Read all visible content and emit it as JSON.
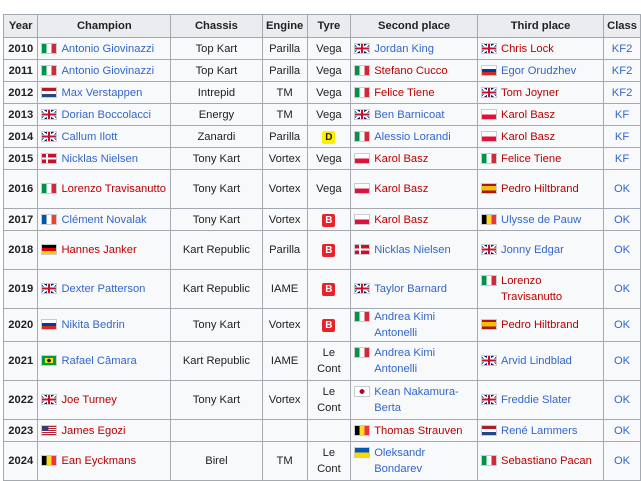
{
  "colors": {
    "link_blue": "#3366cc",
    "link_red": "#ba0000",
    "header_bg": "#eaecf0",
    "border": "#a2a9b1"
  },
  "headers": [
    "Year",
    "Champion",
    "Chassis",
    "Engine",
    "Tyre",
    "Second place",
    "Third place",
    "Class"
  ],
  "rows": [
    {
      "year": "2010",
      "champion": {
        "flag": "it",
        "name": "Antonio Giovinazzi",
        "color": "blue"
      },
      "chassis": "Top Kart",
      "engine": "Parilla",
      "tyre": {
        "text": "Vega"
      },
      "second": {
        "flag": "gb",
        "name": "Jordan King",
        "color": "blue"
      },
      "third": {
        "flag": "gb",
        "name": "Chris Lock",
        "color": "red"
      },
      "cls": "KF2"
    },
    {
      "year": "2011",
      "champion": {
        "flag": "it",
        "name": "Antonio Giovinazzi",
        "color": "blue"
      },
      "chassis": "Top Kart",
      "engine": "Parilla",
      "tyre": {
        "text": "Vega"
      },
      "second": {
        "flag": "it",
        "name": "Stefano Cucco",
        "color": "red"
      },
      "third": {
        "flag": "ru",
        "name": "Egor Orudzhev",
        "color": "blue"
      },
      "cls": "KF2"
    },
    {
      "year": "2012",
      "champion": {
        "flag": "nl",
        "name": "Max Verstappen",
        "color": "blue"
      },
      "chassis": "Intrepid",
      "engine": "TM",
      "tyre": {
        "text": "Vega"
      },
      "second": {
        "flag": "it",
        "name": "Felice Tiene",
        "color": "red"
      },
      "third": {
        "flag": "gb",
        "name": "Tom Joyner",
        "color": "red"
      },
      "cls": "KF2"
    },
    {
      "year": "2013",
      "champion": {
        "flag": "gb",
        "name": "Dorian Boccolacci",
        "color": "blue"
      },
      "chassis": "Energy",
      "engine": "TM",
      "tyre": {
        "text": "Vega"
      },
      "second": {
        "flag": "gb",
        "name": "Ben Barnicoat",
        "color": "blue"
      },
      "third": {
        "flag": "pl",
        "name": "Karol Basz",
        "color": "red"
      },
      "cls": "KF"
    },
    {
      "year": "2014",
      "champion": {
        "flag": "gb",
        "name": "Callum Ilott",
        "color": "blue"
      },
      "chassis": "Zanardi",
      "engine": "Parilla",
      "tyre": {
        "badge": "D",
        "badge_bg": "#ffee00",
        "badge_fg": "#202122"
      },
      "second": {
        "flag": "it",
        "name": "Alessio Lorandi",
        "color": "blue"
      },
      "third": {
        "flag": "pl",
        "name": "Karol Basz",
        "color": "red"
      },
      "cls": "KF"
    },
    {
      "year": "2015",
      "champion": {
        "flag": "dk",
        "name": "Nicklas Nielsen",
        "color": "blue"
      },
      "chassis": "Tony Kart",
      "engine": "Vortex",
      "tyre": {
        "text": "Vega"
      },
      "second": {
        "flag": "pl",
        "name": "Karol Basz",
        "color": "red"
      },
      "third": {
        "flag": "it",
        "name": "Felice Tiene",
        "color": "red"
      },
      "cls": "KF"
    },
    {
      "year": "2016",
      "champion": {
        "flag": "it",
        "name": "Lorenzo Travisanutto",
        "color": "red"
      },
      "chassis": "Tony Kart",
      "engine": "Vortex",
      "tyre": {
        "text": "Vega"
      },
      "second": {
        "flag": "pl",
        "name": "Karol Basz",
        "color": "red"
      },
      "third": {
        "flag": "es",
        "name": "Pedro Hiltbrand",
        "color": "red"
      },
      "cls": "OK"
    },
    {
      "year": "2017",
      "champion": {
        "flag": "fr",
        "name": "Clément Novalak",
        "color": "blue"
      },
      "chassis": "Tony Kart",
      "engine": "Vortex",
      "tyre": {
        "badge": "B",
        "badge_bg": "#e8222a",
        "badge_fg": "#ffffff"
      },
      "second": {
        "flag": "pl",
        "name": "Karol Basz",
        "color": "red"
      },
      "third": {
        "flag": "be",
        "name": "Ulysse de Pauw",
        "color": "blue"
      },
      "cls": "OK"
    },
    {
      "year": "2018",
      "champion": {
        "flag": "de",
        "name": "Hannes Janker",
        "color": "red"
      },
      "chassis": "Kart Republic",
      "engine": "Parilla",
      "tyre": {
        "badge": "B",
        "badge_bg": "#e8222a",
        "badge_fg": "#ffffff"
      },
      "second": {
        "flag": "dk",
        "name": "Nicklas Nielsen",
        "color": "blue"
      },
      "third": {
        "flag": "gb",
        "name": "Jonny Edgar",
        "color": "blue"
      },
      "cls": "OK"
    },
    {
      "year": "2019",
      "champion": {
        "flag": "gb",
        "name": "Dexter Patterson",
        "color": "blue"
      },
      "chassis": "Kart Republic",
      "engine": "IAME",
      "tyre": {
        "badge": "B",
        "badge_bg": "#e8222a",
        "badge_fg": "#ffffff"
      },
      "second": {
        "flag": "gb",
        "name": "Taylor Barnard",
        "color": "blue"
      },
      "third": {
        "flag": "it",
        "name": "Lorenzo Travisanutto",
        "color": "red"
      },
      "cls": "OK"
    },
    {
      "year": "2020",
      "champion": {
        "flag": "ru",
        "name": "Nikita Bedrin",
        "color": "blue"
      },
      "chassis": "Tony Kart",
      "engine": "Vortex",
      "tyre": {
        "badge": "B",
        "badge_bg": "#e8222a",
        "badge_fg": "#ffffff"
      },
      "second": {
        "flag": "it",
        "name": "Andrea Kimi Antonelli",
        "color": "blue"
      },
      "third": {
        "flag": "es",
        "name": "Pedro Hiltbrand",
        "color": "red"
      },
      "cls": "OK"
    },
    {
      "year": "2021",
      "champion": {
        "flag": "br",
        "name": "Rafael Câmara",
        "color": "blue"
      },
      "chassis": "Kart Republic",
      "engine": "IAME",
      "tyre": {
        "text": "Le Cont"
      },
      "second": {
        "flag": "it",
        "name": "Andrea Kimi Antonelli",
        "color": "blue"
      },
      "third": {
        "flag": "gb",
        "name": "Arvid Lindblad",
        "color": "blue"
      },
      "cls": "OK"
    },
    {
      "year": "2022",
      "champion": {
        "flag": "gb",
        "name": "Joe Turney",
        "color": "red"
      },
      "chassis": "Tony Kart",
      "engine": "Vortex",
      "tyre": {
        "text": "Le Cont"
      },
      "second": {
        "flag": "jp",
        "name": "Kean Nakamura-Berta",
        "color": "blue"
      },
      "third": {
        "flag": "gb",
        "name": "Freddie Slater",
        "color": "blue"
      },
      "cls": "OK"
    },
    {
      "year": "2023",
      "champion": {
        "flag": "us",
        "name": "James Egozi",
        "color": "red"
      },
      "chassis": "",
      "engine": "",
      "tyre": {
        "text": ""
      },
      "second": {
        "flag": "be",
        "name": "Thomas Strauven",
        "color": "red"
      },
      "third": {
        "flag": "nl",
        "name": "René Lammers",
        "color": "blue"
      },
      "cls": "OK"
    },
    {
      "year": "2024",
      "champion": {
        "flag": "be",
        "name": "Ean Eyckmans",
        "color": "red"
      },
      "chassis": "Birel",
      "engine": "TM",
      "tyre": {
        "text": "Le Cont"
      },
      "second": {
        "flag": "ua",
        "name": "Oleksandr Bondarev",
        "color": "blue"
      },
      "third": {
        "flag": "it",
        "name": "Sebastiano Pacan",
        "color": "red"
      },
      "cls": "OK"
    }
  ]
}
